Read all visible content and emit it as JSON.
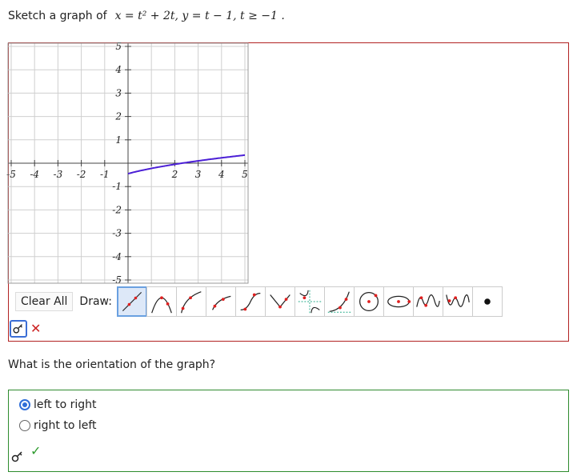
{
  "prompt": {
    "text": "Sketch a graph of",
    "math": "x = t² + 2t, y = t − 1, t ≥ −1 ."
  },
  "graph": {
    "x_ticks": [
      "-5",
      "-4",
      "-3",
      "-2",
      "-1",
      "2",
      "3",
      "4",
      "5"
    ],
    "y_ticks": [
      "5",
      "4",
      "3",
      "2",
      "1",
      "-1",
      "-2",
      "-3",
      "-4",
      "-5"
    ],
    "curve_color": "#4b1fd6"
  },
  "toolbar": {
    "clear_label": "Clear All",
    "draw_label": "Draw:",
    "tools": [
      "line-tool-icon",
      "parabola-tool-icon",
      "sqrt-tool-icon",
      "log-tool-icon",
      "cubic-tool-icon",
      "abs-value-tool-icon",
      "rational-tool-icon",
      "exponential-tool-icon",
      "circle-tool-icon",
      "ellipse-tool-icon",
      "sine-tool-icon",
      "cosine-tool-icon",
      "point-tool-icon"
    ]
  },
  "question": {
    "text": "What is the orientation of the graph?",
    "options": [
      {
        "label": "left to right",
        "checked": true
      },
      {
        "label": "right to left",
        "checked": false
      }
    ]
  },
  "colors": {
    "wrong": "#cc2222",
    "correct": "#2e9b2e",
    "accent": "#2f6ed8"
  }
}
